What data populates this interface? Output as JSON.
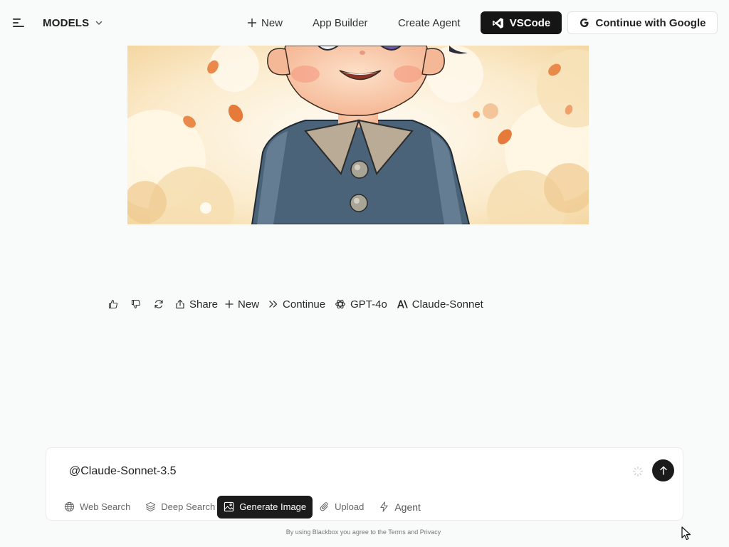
{
  "header": {
    "models_label": "MODELS",
    "new_label": "New",
    "app_builder_label": "App Builder",
    "create_agent_label": "Create Agent",
    "vscode_label": "VSCode",
    "google_label": "Continue with Google"
  },
  "actions": {
    "share_label": "Share",
    "new_label": "New",
    "continue_label": "Continue",
    "gpt_label": "GPT-4o",
    "claude_label": "Claude-Sonnet"
  },
  "composer": {
    "text": "@Claude-Sonnet-3.5",
    "tools": {
      "web_search": "Web Search",
      "deep_search": "Deep Search",
      "generate_image": "Generate Image",
      "upload": "Upload",
      "agent": "Agent"
    }
  },
  "footer": {
    "note": "By using Blackbox you agree to the Terms and Privacy"
  },
  "colors": {
    "background": "#f9fafa",
    "dark_button": "#1b1b1b",
    "image_background": "#f6dfb2",
    "jacket": "#4a6378"
  },
  "icons": [
    "menu-icon",
    "chevron-down-icon",
    "plus-icon",
    "vscode-icon",
    "google-icon",
    "thumbs-up-icon",
    "thumbs-down-icon",
    "refresh-icon",
    "share-icon",
    "double-chevron-icon",
    "openai-icon",
    "anthropic-icon",
    "globe-icon",
    "layers-icon",
    "image-icon",
    "paperclip-icon",
    "sparkle-icon",
    "arrow-up-icon"
  ]
}
